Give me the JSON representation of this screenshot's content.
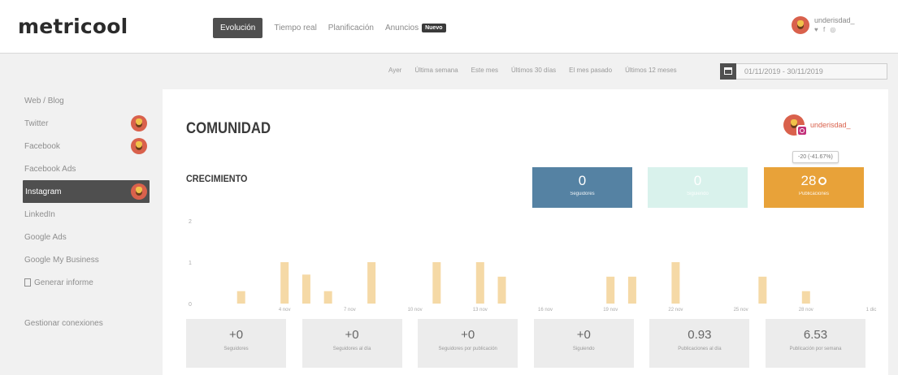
{
  "brand": {
    "logo": "metricool"
  },
  "nav": {
    "items": [
      "Evolución",
      "Tiempo real",
      "Planificación",
      "Anuncios"
    ],
    "new_badge": "Nuevo"
  },
  "user": {
    "name": "underisdad_",
    "social": "♥ f ◎"
  },
  "date_bar": {
    "ranges": [
      "Ayer",
      "Última semana",
      "Este mes",
      "Últimos 30 días",
      "El mes pasado",
      "Últimos 12 meses"
    ],
    "date_range": "01/11/2019 - 30/11/2019"
  },
  "sidebar": {
    "items": [
      {
        "label": "Web / Blog",
        "avatar": false
      },
      {
        "label": "Twitter",
        "avatar": true
      },
      {
        "label": "Facebook",
        "avatar": true
      },
      {
        "label": "Facebook Ads",
        "avatar": false
      },
      {
        "label": "Instagram",
        "avatar": true,
        "active": true
      },
      {
        "label": "LinkedIn",
        "avatar": false
      },
      {
        "label": "Google Ads",
        "avatar": false
      },
      {
        "label": "Google My Business",
        "avatar": false
      }
    ],
    "report": "Generar informe",
    "connections": "Gestionar conexiones"
  },
  "main": {
    "title": "COMUNIDAD",
    "account": "underisdad_",
    "subtitle": "CRECIMIENTO"
  },
  "kpis": [
    {
      "value": "0",
      "label": "Seguidores",
      "color": "#5582a3"
    },
    {
      "value": "0",
      "label": "Siguiendo",
      "color": "#d9f2ec"
    },
    {
      "value": "28",
      "label": "Publicaciones",
      "color": "#e8a239"
    }
  ],
  "tooltip": "-20 (-41.67%)",
  "stats": [
    {
      "value": "+0",
      "label": "Seguidores"
    },
    {
      "value": "+0",
      "label": "Seguidores al día"
    },
    {
      "value": "+0",
      "label": "Seguidores por publicación"
    },
    {
      "value": "+0",
      "label": "Siguiendo"
    },
    {
      "value": "0.93",
      "label": "Publicaciones al día"
    },
    {
      "value": "6.53",
      "label": "Publicación por semana"
    }
  ],
  "chart_data": {
    "type": "bar",
    "color": "#f5d9a6",
    "yticks": [
      "2",
      "1",
      "0"
    ],
    "ylim": [
      0,
      2
    ],
    "xticks": [
      "4 nov",
      "7 nov",
      "10 nov",
      "13 nov",
      "16 nov",
      "19 nov",
      "22 nov",
      "25 nov",
      "28 nov",
      "1 dic"
    ],
    "x_days": [
      2,
      4,
      5,
      6,
      8,
      11,
      13,
      14,
      19,
      20,
      22,
      26,
      28
    ],
    "values": [
      0.3,
      1,
      0.7,
      0.3,
      1,
      1,
      1,
      0.65,
      0.65,
      0.65,
      1,
      0.65,
      0.3
    ]
  }
}
